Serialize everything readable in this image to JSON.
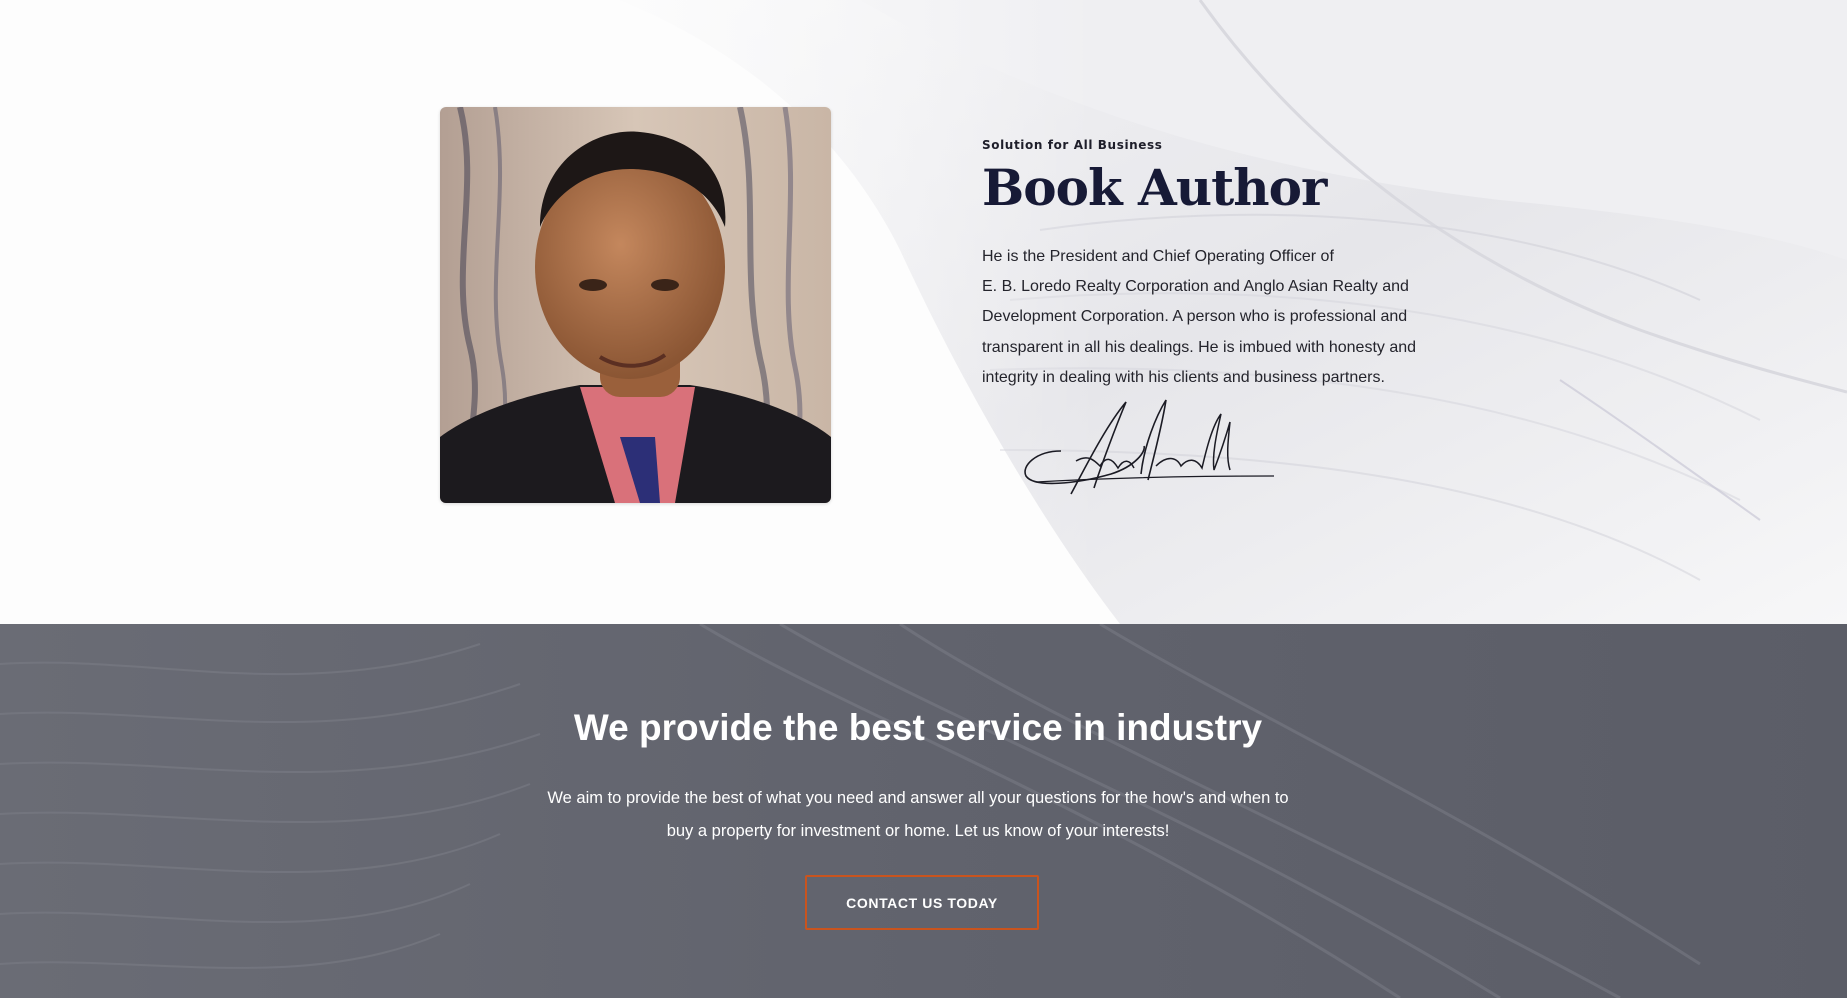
{
  "author": {
    "eyebrow": "Solution for All Business",
    "title": "Book Author",
    "bio_lines": [
      "He is the President and Chief Operating Officer of",
      "E. B. Loredo Realty Corporation and Anglo Asian Realty and",
      "Development Corporation. A person who is professional and",
      "transparent in all his dealings. He is imbued with honesty and",
      "integrity in dealing with his clients and business partners."
    ],
    "portrait_icon": "portrait-photo",
    "signature_icon": "handwritten-signature"
  },
  "cta": {
    "heading": "We provide the best service in industry",
    "text_lines": [
      "We aim to provide the best of what you need and answer all your questions for the how's and when to",
      "buy a property for investment or home.  Let us know of your interests!"
    ],
    "button_label": "CONTACT US TODAY"
  },
  "colors": {
    "title": "#171a36",
    "cta_background": "#5d5f69",
    "button_border": "#c9541e",
    "text_light": "#ffffff"
  }
}
